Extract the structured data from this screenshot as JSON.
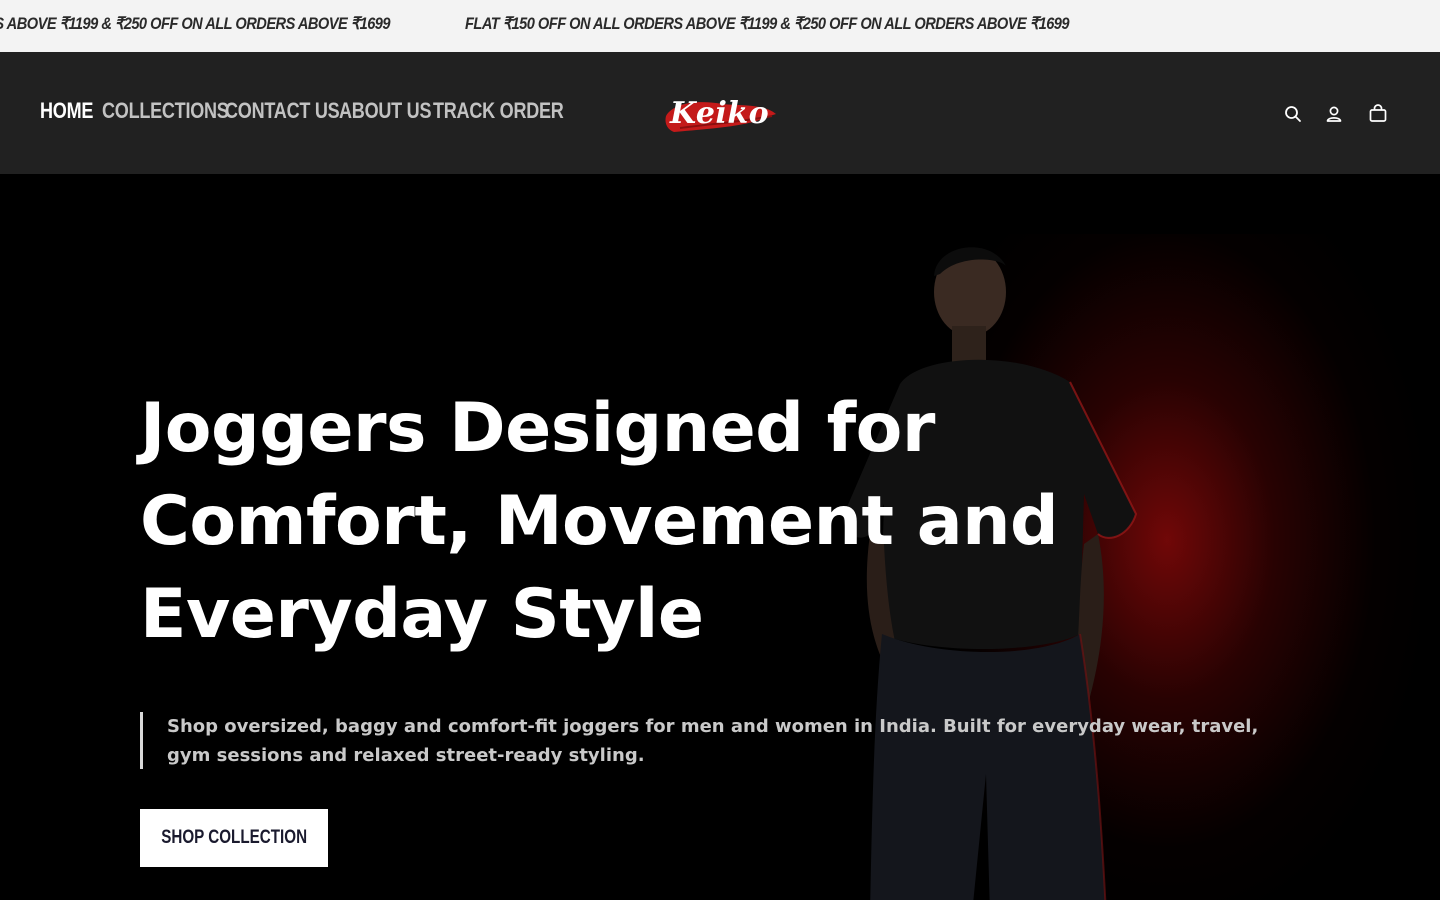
{
  "announcement": {
    "messages": [
      "FLAT ₹150 OFF ON ALL ORDERS ABOVE ₹1199 & ₹250 OFF ON ALL ORDERS ABOVE ₹1699",
      "FLAT ₹150 OFF ON ALL ORDERS ABOVE ₹1199 & ₹250 OFF ON ALL ORDERS ABOVE ₹1699"
    ]
  },
  "header": {
    "nav": [
      {
        "label": "HOME",
        "active": true
      },
      {
        "label": "COLLECTIONS",
        "active": false
      },
      {
        "label": "CONTACT US",
        "active": false
      },
      {
        "label": "ABOUT US",
        "active": false
      },
      {
        "label": "TRACK ORDER",
        "active": false
      }
    ],
    "logo_text": "Keiko",
    "icons": [
      "search-icon",
      "account-icon",
      "cart-icon"
    ]
  },
  "hero": {
    "headline_lines": [
      "Joggers Designed for",
      "Comfort, Movement and",
      "Everyday Style"
    ],
    "subtext": "Shop oversized, baggy and comfort-fit joggers for men and women in India. Built for everyday wear, travel, gym sessions and relaxed street-ready styling.",
    "cta_label": "SHOP COLLECTION"
  },
  "colors": {
    "announcement_bg": "#f3f3f3",
    "header_bg": "#212121",
    "hero_bg": "#000000",
    "accent_red": "#c41a1a"
  }
}
